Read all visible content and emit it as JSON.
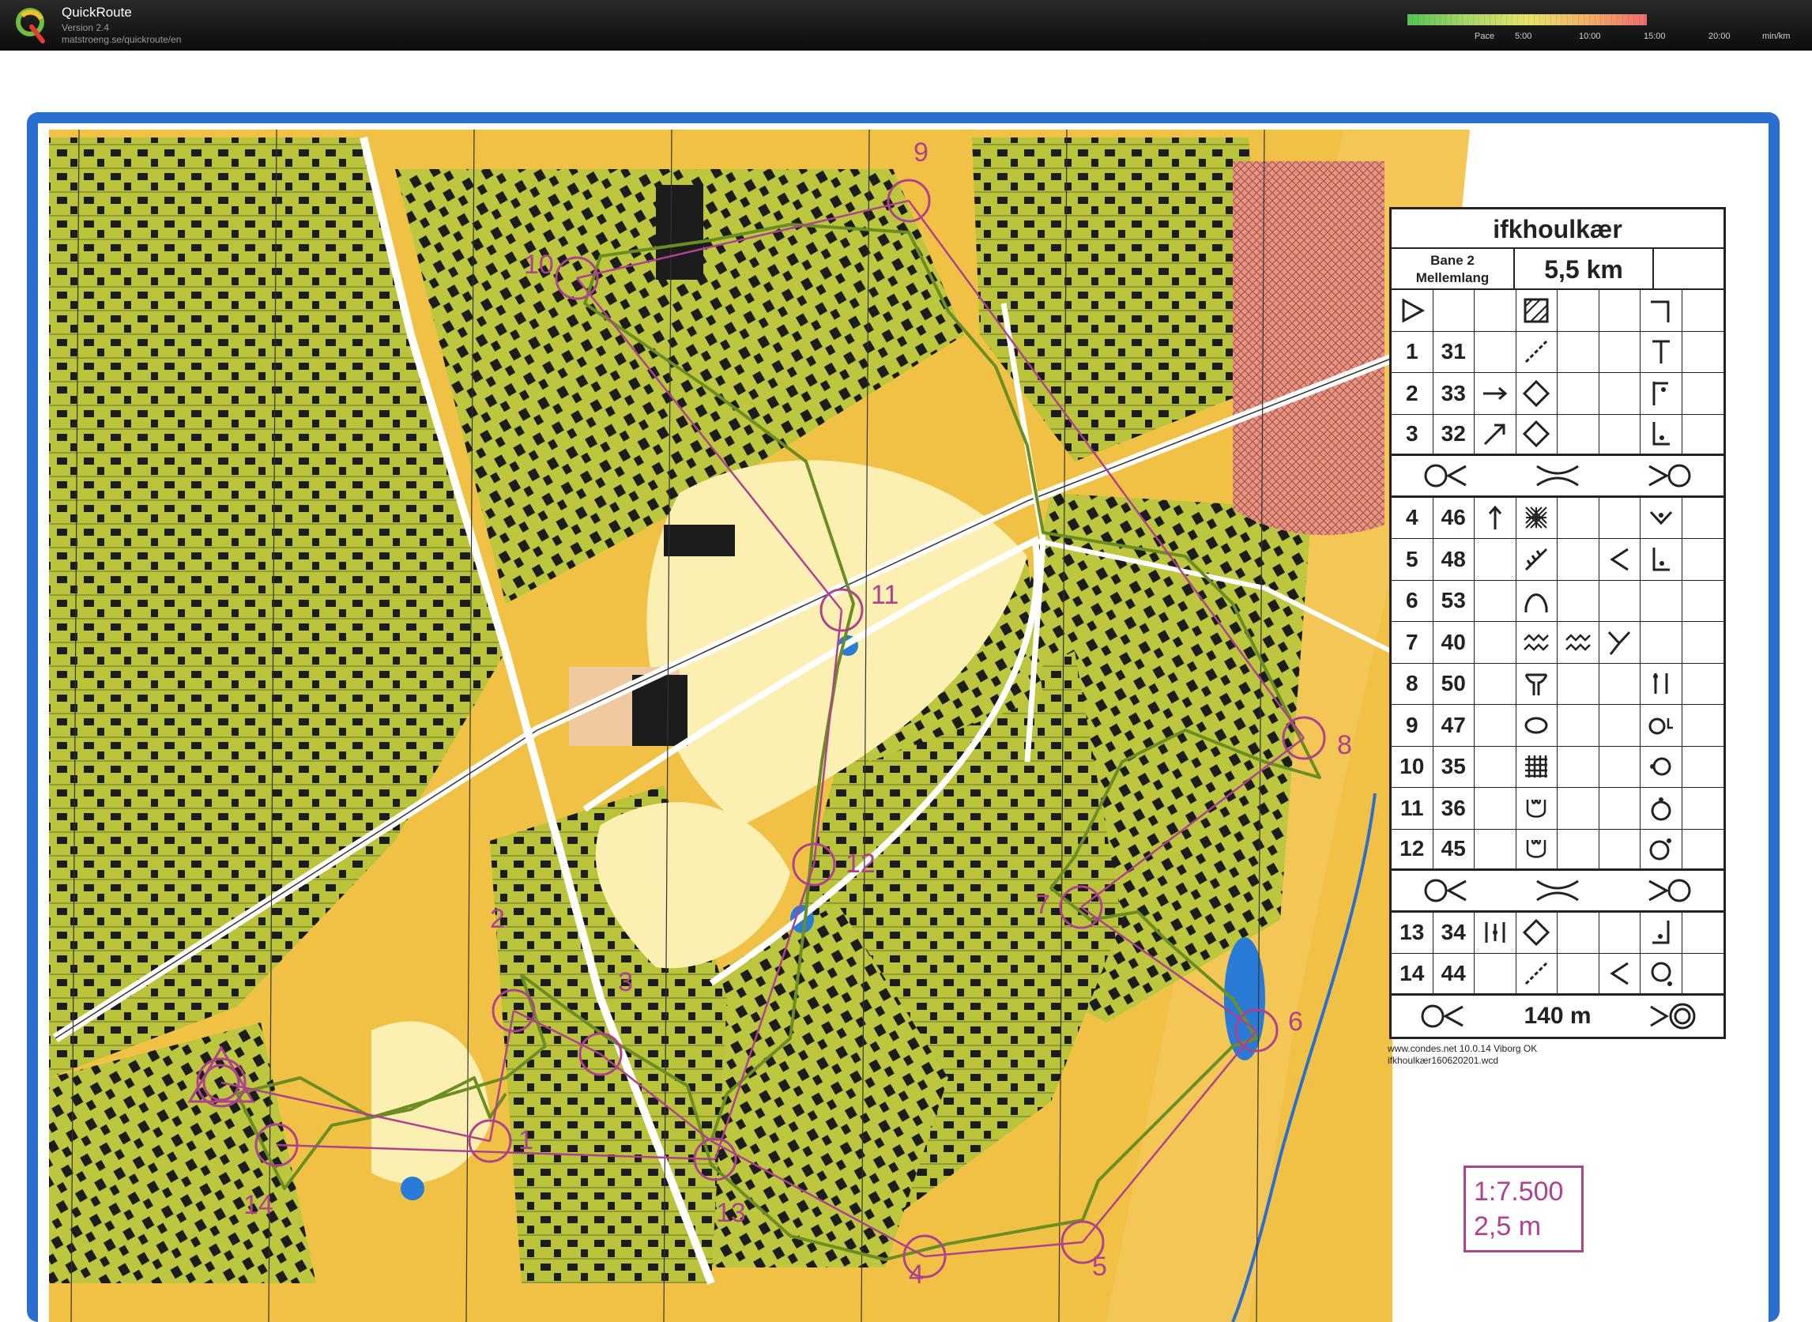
{
  "header": {
    "title": "QuickRoute",
    "version": "Version 2.4",
    "url": "matstroeng.se/quickroute/en",
    "logo_icon": "quickroute-logo-icon"
  },
  "pace_legend": {
    "label": "Pace",
    "ticks": [
      "5:00",
      "10:00",
      "15:00",
      "20:00"
    ],
    "unit": "min/km",
    "colors": [
      "#55c255",
      "#a9d66a",
      "#e6e46a",
      "#f2b068",
      "#ef6c6c"
    ]
  },
  "map": {
    "course_color": "#b0418f",
    "route_color": "#6b8e23",
    "controls": [
      "1",
      "2",
      "3",
      "4",
      "5",
      "6",
      "7",
      "8",
      "9",
      "10",
      "11",
      "12",
      "13",
      "14"
    ],
    "scale": "1:7.500",
    "contour_interval": "2,5 m"
  },
  "description": {
    "event": "ifkhoulkær",
    "course": "Bane 2",
    "course_class": "Mellemlang",
    "length": "5,5 km",
    "rows": [
      {
        "no": "1",
        "code": "31"
      },
      {
        "no": "2",
        "code": "33"
      },
      {
        "no": "3",
        "code": "32"
      },
      {
        "no": "4",
        "code": "46"
      },
      {
        "no": "5",
        "code": "48"
      },
      {
        "no": "6",
        "code": "53"
      },
      {
        "no": "7",
        "code": "40"
      },
      {
        "no": "8",
        "code": "50"
      },
      {
        "no": "9",
        "code": "47"
      },
      {
        "no": "10",
        "code": "35"
      },
      {
        "no": "11",
        "code": "36"
      },
      {
        "no": "12",
        "code": "45"
      },
      {
        "no": "13",
        "code": "34"
      },
      {
        "no": "14",
        "code": "44"
      }
    ],
    "finish_distance": "140 m",
    "footer_line1": "www.condes.net 10.0.14 Viborg OK",
    "footer_line2": "ifkhoulkær160620201.wcd"
  }
}
